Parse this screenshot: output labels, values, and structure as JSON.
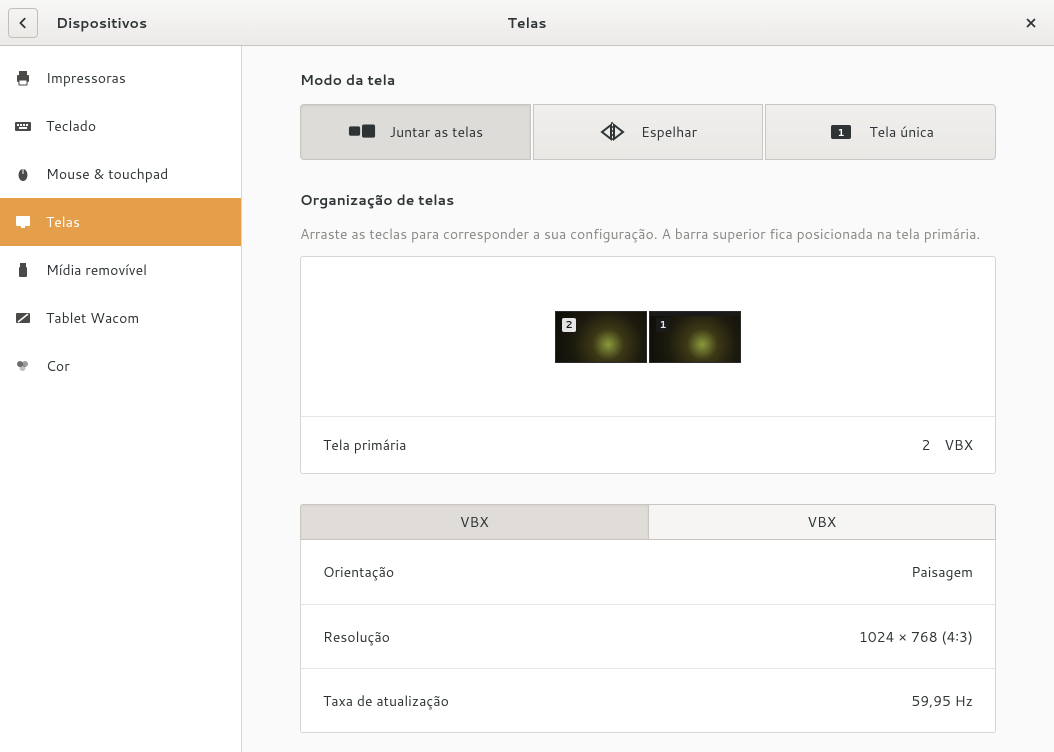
{
  "titlebar": {
    "left_label": "Dispositivos",
    "center_label": "Telas"
  },
  "sidebar": {
    "items": [
      {
        "id": "printers",
        "label": "Impressoras",
        "active": false
      },
      {
        "id": "keyboard",
        "label": "Teclado",
        "active": false
      },
      {
        "id": "mouse",
        "label": "Mouse & touchpad",
        "active": false
      },
      {
        "id": "displays",
        "label": "Telas",
        "active": true
      },
      {
        "id": "removable",
        "label": "Mídia removível",
        "active": false
      },
      {
        "id": "wacom",
        "label": "Tablet Wacom",
        "active": false
      },
      {
        "id": "color",
        "label": "Cor",
        "active": false
      }
    ]
  },
  "display_mode": {
    "title": "Modo da tela",
    "options": [
      {
        "id": "join",
        "label": "Juntar as telas",
        "active": true
      },
      {
        "id": "mirror",
        "label": "Espelhar",
        "active": false
      },
      {
        "id": "single",
        "label": "Tela única",
        "active": false
      }
    ]
  },
  "arrangement": {
    "title": "Organização de telas",
    "help": "Arraste as teclas para corresponder a sua configuração. A barra superior fica posicionada na tela primária.",
    "monitors": [
      {
        "num": "2",
        "primary": false
      },
      {
        "num": "1",
        "primary": true
      }
    ],
    "primary_label": "Tela primária",
    "primary_value_num": "2",
    "primary_value_name": "VBX"
  },
  "monitor_tabs": {
    "tabs": [
      {
        "label": "VBX",
        "active": true
      },
      {
        "label": "VBX",
        "active": false
      }
    ],
    "settings": [
      {
        "label": "Orientação",
        "value": "Paisagem"
      },
      {
        "label": "Resolução",
        "value": "1024 × 768 (4∶3)"
      },
      {
        "label": "Taxa de atualização",
        "value": "59,95 Hz"
      }
    ]
  }
}
